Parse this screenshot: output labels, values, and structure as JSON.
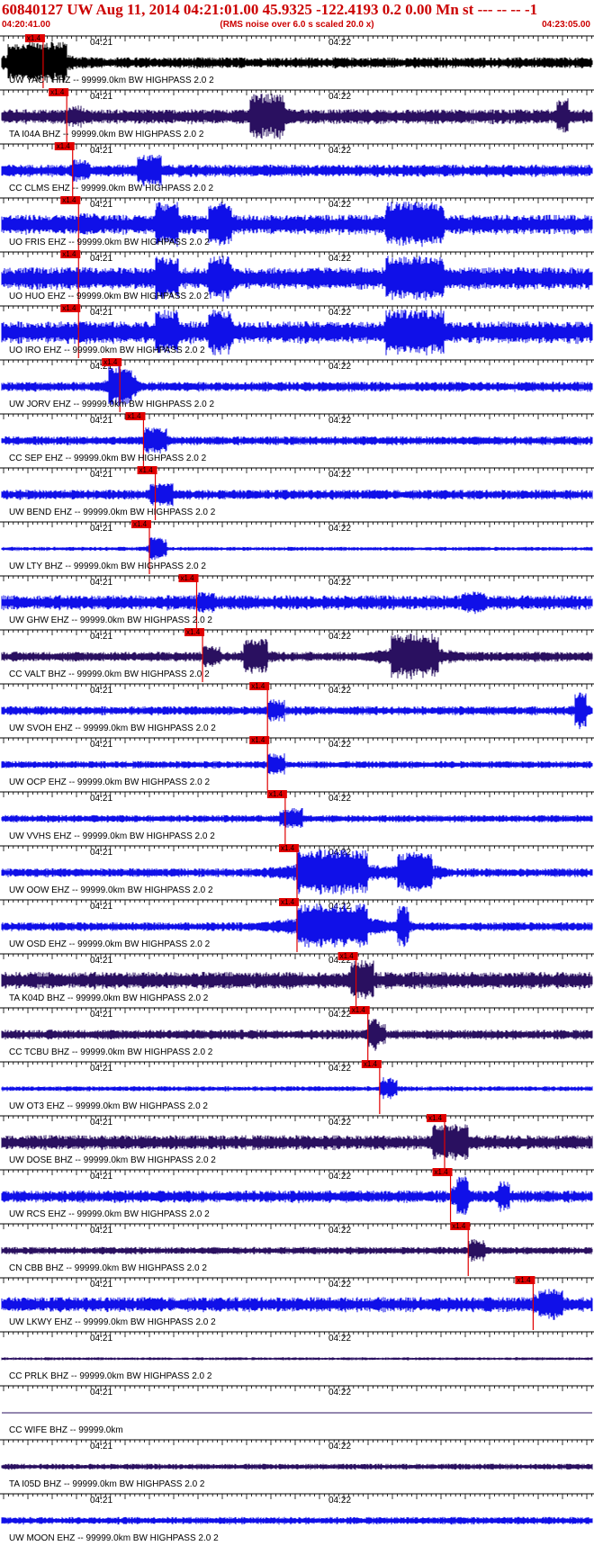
{
  "header": {
    "title": "60840127 UW Aug 11, 2014 04:21:01.00   45.9325 -122.4193  0.2 0.00 Mn st --- -- --  -1",
    "start_time": "04:20:41.00",
    "noise_note": "(RMS noise over 6.0 s scaled 20.0 x)",
    "end_time": "04:23:05.00"
  },
  "time_marks": [
    "04:21",
    "04:22"
  ],
  "pick_label": "x1.4",
  "colors": {
    "blue": "#1010e8",
    "purple": "#2a1060",
    "black": "#000000",
    "red": "#e00000"
  },
  "traces": [
    {
      "label": "UW YACT HHZ -- 99999.0km BW  HIGHPASS  2.0  2",
      "color": "black",
      "pick": 0.07,
      "amp": 0.22,
      "bursts": [
        [
          0.06,
          0.05,
          0.9
        ]
      ]
    },
    {
      "label": "TA I04A BHZ -- 99999.0km BW  HIGHPASS  2.0  2",
      "color": "purple",
      "pick": 0.11,
      "amp": 0.3,
      "bursts": [
        [
          0.45,
          0.03,
          1.0
        ],
        [
          0.95,
          0.01,
          0.8
        ]
      ]
    },
    {
      "label": "CC CLMS EHZ -- 99999.0km BW  HIGHPASS  2.0  2",
      "color": "blue",
      "pick": 0.12,
      "amp": 0.25,
      "bursts": [
        [
          0.25,
          0.02,
          0.7
        ]
      ]
    },
    {
      "label": "UO FRIS EHZ -- 99999.0km BW  HIGHPASS  2.0  2",
      "color": "blue",
      "pick": 0.13,
      "amp": 0.4,
      "bursts": [
        [
          0.28,
          0.02,
          1.0
        ],
        [
          0.37,
          0.02,
          1.0
        ],
        [
          0.7,
          0.05,
          1.0
        ]
      ]
    },
    {
      "label": "UO HUO EHZ -- 99999.0km BW  HIGHPASS  2.0  2",
      "color": "blue",
      "pick": 0.13,
      "amp": 0.45,
      "bursts": [
        [
          0.28,
          0.02,
          1.0
        ],
        [
          0.37,
          0.02,
          1.0
        ],
        [
          0.7,
          0.05,
          1.0
        ]
      ]
    },
    {
      "label": "UO IRO EHZ -- 99999.0km BW  HIGHPASS  2.0  2",
      "color": "blue",
      "pick": 0.13,
      "amp": 0.45,
      "bursts": [
        [
          0.28,
          0.02,
          1.0
        ],
        [
          0.37,
          0.02,
          1.0
        ],
        [
          0.7,
          0.05,
          1.0
        ]
      ]
    },
    {
      "label": "UW JORV EHZ -- 99999.0km BW  HIGHPASS  2.0  2",
      "color": "blue",
      "pick": 0.2,
      "amp": 0.2,
      "bursts": [
        [
          0.2,
          0.02,
          0.9
        ]
      ]
    },
    {
      "label": "CC SEP EHZ -- 99999.0km BW  HIGHPASS  2.0  2",
      "color": "blue",
      "pick": 0.24,
      "amp": 0.18,
      "bursts": [
        [
          0.26,
          0.02,
          0.6
        ]
      ]
    },
    {
      "label": "UW BEND EHZ -- 99999.0km BW  HIGHPASS  2.0  2",
      "color": "blue",
      "pick": 0.26,
      "amp": 0.2,
      "bursts": [
        [
          0.27,
          0.02,
          0.5
        ]
      ]
    },
    {
      "label": "UW LTY BHZ -- 99999.0km BW  HIGHPASS  2.0  2",
      "color": "blue",
      "pick": 0.25,
      "amp": 0.08,
      "bursts": [
        [
          0.26,
          0.01,
          0.5
        ]
      ]
    },
    {
      "label": "UW GHW EHZ -- 99999.0km BW  HIGHPASS  2.0  2",
      "color": "blue",
      "pick": 0.33,
      "amp": 0.3,
      "bursts": [
        [
          0.8,
          0.02,
          0.5
        ]
      ]
    },
    {
      "label": "CC VALT BHZ -- 99999.0km BW  HIGHPASS  2.0  2",
      "color": "purple",
      "pick": 0.34,
      "amp": 0.2,
      "bursts": [
        [
          0.43,
          0.02,
          0.8
        ],
        [
          0.7,
          0.04,
          1.0
        ]
      ]
    },
    {
      "label": "UW SVOH EHZ -- 99999.0km BW  HIGHPASS  2.0  2",
      "color": "blue",
      "pick": 0.45,
      "amp": 0.18,
      "bursts": [
        [
          0.98,
          0.01,
          0.8
        ]
      ]
    },
    {
      "label": "UW OCP EHZ -- 99999.0km BW  HIGHPASS  2.0  2",
      "color": "blue",
      "pick": 0.45,
      "amp": 0.15,
      "bursts": []
    },
    {
      "label": "UW VVHS EHZ -- 99999.0km BW  HIGHPASS  2.0  2",
      "color": "blue",
      "pick": 0.48,
      "amp": 0.15,
      "bursts": [
        [
          0.49,
          0.02,
          0.4
        ]
      ]
    },
    {
      "label": "UW OOW EHZ -- 99999.0km BW  HIGHPASS  2.0  2",
      "color": "blue",
      "pick": 0.5,
      "amp": 0.18,
      "bursts": [
        [
          0.56,
          0.06,
          1.0
        ],
        [
          0.7,
          0.03,
          0.9
        ]
      ]
    },
    {
      "label": "UW OSD EHZ -- 99999.0km BW  HIGHPASS  2.0  2",
      "color": "blue",
      "pick": 0.5,
      "amp": 0.18,
      "bursts": [
        [
          0.56,
          0.06,
          1.0
        ],
        [
          0.68,
          0.01,
          0.9
        ]
      ]
    },
    {
      "label": "TA K04D BHZ -- 99999.0km BW  HIGHPASS  2.0  2",
      "color": "purple",
      "pick": 0.6,
      "amp": 0.35,
      "bursts": [
        [
          0.61,
          0.02,
          0.9
        ]
      ]
    },
    {
      "label": "CC TCBU BHZ -- 99999.0km BW  HIGHPASS  2.0  2",
      "color": "purple",
      "pick": 0.62,
      "amp": 0.2,
      "bursts": [
        [
          0.63,
          0.01,
          0.7
        ]
      ]
    },
    {
      "label": "UW OT3 EHZ -- 99999.0km BW  HIGHPASS  2.0  2",
      "color": "blue",
      "pick": 0.64,
      "amp": 0.1,
      "bursts": [
        [
          0.65,
          0.01,
          0.3
        ]
      ]
    },
    {
      "label": "UW DOSE BHZ -- 99999.0km BW  HIGHPASS  2.0  2",
      "color": "purple",
      "pick": 0.75,
      "amp": 0.3,
      "bursts": [
        [
          0.76,
          0.03,
          0.8
        ]
      ]
    },
    {
      "label": "UW RCS EHZ -- 99999.0km BW  HIGHPASS  2.0  2",
      "color": "blue",
      "pick": 0.76,
      "amp": 0.25,
      "bursts": [
        [
          0.78,
          0.01,
          1.0
        ],
        [
          0.85,
          0.01,
          0.7
        ]
      ]
    },
    {
      "label": "CN CBB BHZ -- 99999.0km BW  HIGHPASS  2.0  2",
      "color": "purple",
      "pick": 0.79,
      "amp": 0.15,
      "bursts": []
    },
    {
      "label": "UW LKWY EHZ -- 99999.0km BW  HIGHPASS  2.0  2",
      "color": "blue",
      "pick": 0.9,
      "amp": 0.3,
      "bursts": [
        [
          0.93,
          0.02,
          0.7
        ]
      ]
    },
    {
      "label": "CC PRLK BHZ -- 99999.0km BW  HIGHPASS  2.0  2",
      "color": "purple",
      "pick": null,
      "amp": 0.06,
      "bursts": []
    },
    {
      "label": "CC WIFE BHZ -- 99999.0km",
      "color": "purple",
      "pick": null,
      "amp": 0.0,
      "bursts": []
    },
    {
      "label": "TA I05D BHZ -- 99999.0km BW  HIGHPASS  2.0  2",
      "color": "purple",
      "pick": null,
      "amp": 0.12,
      "bursts": []
    },
    {
      "label": "UW MOON EHZ -- 99999.0km BW  HIGHPASS  2.0  2",
      "color": "blue",
      "pick": null,
      "amp": 0.15,
      "bursts": []
    }
  ]
}
